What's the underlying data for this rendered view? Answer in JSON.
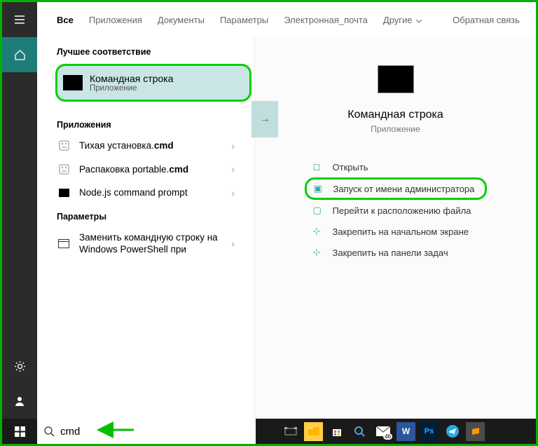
{
  "tabs": {
    "all": "Все",
    "apps": "Приложения",
    "docs": "Документы",
    "settings": "Параметры",
    "email": "Электронная_почта",
    "others": "Другие",
    "feedback": "Обратная связь"
  },
  "sections": {
    "best": "Лучшее соответствие",
    "apps": "Приложения",
    "params": "Параметры"
  },
  "best_match": {
    "title": "Командная строка",
    "subtitle": "Приложение"
  },
  "apps_list": [
    {
      "prefix": "Тихая установка.",
      "bold": "cmd"
    },
    {
      "prefix": "Распаковка portable.",
      "bold": "cmd"
    },
    {
      "prefix": "Node.js command prompt",
      "bold": ""
    }
  ],
  "params_list": [
    {
      "text": "Заменить командную строку на Windows PowerShell при"
    }
  ],
  "preview": {
    "title": "Командная строка",
    "subtitle": "Приложение"
  },
  "actions": {
    "open": "Открыть",
    "admin": "Запуск от имени администратора",
    "location": "Перейти к расположению файла",
    "pin_start": "Закрепить на начальном экране",
    "pin_taskbar": "Закрепить на панели задач"
  },
  "search": {
    "value": "cmd"
  },
  "mail_badge": "46"
}
